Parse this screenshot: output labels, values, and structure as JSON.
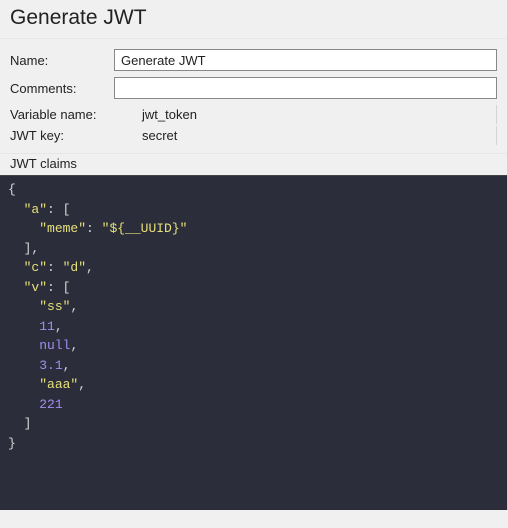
{
  "header": {
    "title": "Generate JWT"
  },
  "form": {
    "name_label": "Name:",
    "name_value": "Generate JWT",
    "comments_label": "Comments:",
    "comments_value": "",
    "variable_name_label": "Variable name:",
    "variable_name_value": "jwt_token",
    "jwt_key_label": "JWT key:",
    "jwt_key_value": "secret",
    "jwt_claims_label": "JWT claims"
  },
  "claims_code": {
    "tokens": [
      [
        [
          "brace",
          "{"
        ]
      ],
      [
        [
          "brace",
          "  "
        ],
        [
          "key",
          "\"a\""
        ],
        [
          "punct",
          ": ["
        ]
      ],
      [
        [
          "brace",
          "    "
        ],
        [
          "key",
          "\"meme\""
        ],
        [
          "punct",
          ": "
        ],
        [
          "str",
          "\"${__UUID}\""
        ]
      ],
      [
        [
          "brace",
          "  "
        ],
        [
          "punct",
          "],"
        ]
      ],
      [
        [
          "brace",
          "  "
        ],
        [
          "key",
          "\"c\""
        ],
        [
          "punct",
          ": "
        ],
        [
          "str",
          "\"d\""
        ],
        [
          "punct",
          ","
        ]
      ],
      [
        [
          "brace",
          "  "
        ],
        [
          "key",
          "\"v\""
        ],
        [
          "punct",
          ": ["
        ]
      ],
      [
        [
          "brace",
          "    "
        ],
        [
          "str",
          "\"ss\""
        ],
        [
          "punct",
          ","
        ]
      ],
      [
        [
          "brace",
          "    "
        ],
        [
          "num",
          "11"
        ],
        [
          "punct",
          ","
        ]
      ],
      [
        [
          "brace",
          "    "
        ],
        [
          "null",
          "null"
        ],
        [
          "punct",
          ","
        ]
      ],
      [
        [
          "brace",
          "    "
        ],
        [
          "num",
          "3.1"
        ],
        [
          "punct",
          ","
        ]
      ],
      [
        [
          "brace",
          "    "
        ],
        [
          "str",
          "\"aaa\""
        ],
        [
          "punct",
          ","
        ]
      ],
      [
        [
          "brace",
          "    "
        ],
        [
          "num",
          "221"
        ]
      ],
      [
        [
          "brace",
          "  "
        ],
        [
          "punct",
          "]"
        ]
      ],
      [
        [
          "brace",
          "}"
        ]
      ]
    ]
  }
}
